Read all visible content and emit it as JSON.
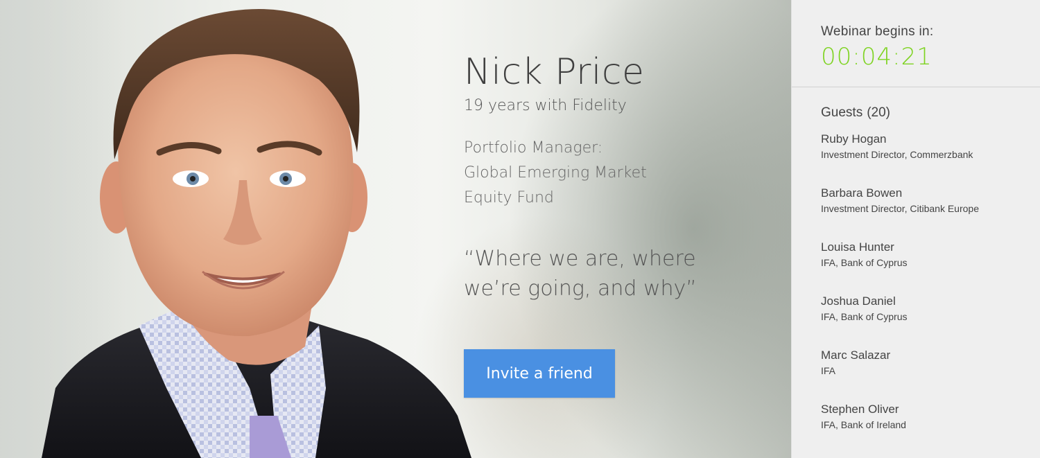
{
  "speaker": {
    "name": "Nick Price",
    "tenure": "19 years with Fidelity",
    "role_lines": [
      "Portfolio Manager:",
      "Global Emerging Market",
      "Equity Fund"
    ],
    "talk_title_lines": [
      "“Where we are, where",
      "we’re going, and why”"
    ],
    "photo_icon": "speaker-portrait"
  },
  "invite_button": {
    "label": "Invite a friend",
    "color": "#4a90e2"
  },
  "countdown": {
    "label": "Webinar begins in:",
    "value": "00:04:21",
    "color": "#7ed321"
  },
  "guests": {
    "label": "Guests",
    "count": "(20)",
    "items": [
      {
        "name": "Ruby Hogan",
        "title": "Investment Director, Commerzbank"
      },
      {
        "name": "Barbara Bowen",
        "title": "Investment Director, Citibank Europe"
      },
      {
        "name": "Louisa Hunter",
        "title": "IFA, Bank of Cyprus"
      },
      {
        "name": "Joshua Daniel",
        "title": "IFA, Bank of Cyprus"
      },
      {
        "name": "Marc Salazar",
        "title": "IFA"
      },
      {
        "name": "Stephen Oliver",
        "title": "IFA, Bank of Ireland"
      }
    ]
  }
}
